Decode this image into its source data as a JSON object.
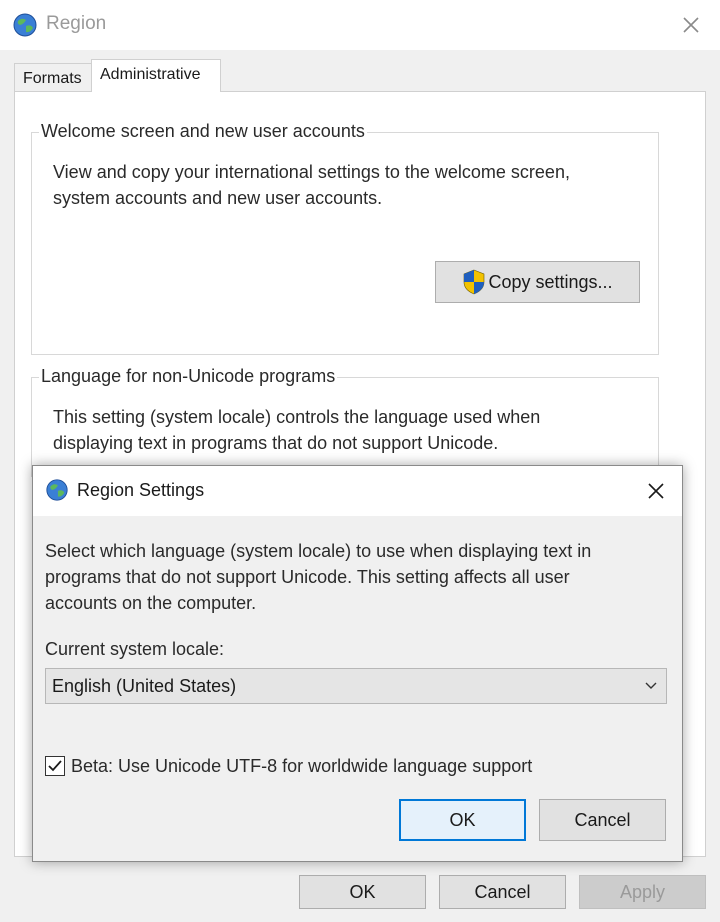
{
  "window": {
    "title": "Region",
    "close_glyph": "✕",
    "tabs": [
      {
        "label": "Formats",
        "active": false
      },
      {
        "label": "Administrative",
        "active": true
      }
    ]
  },
  "welcome_group": {
    "title": "Welcome screen and new user accounts",
    "text_line1": "View and copy your international settings to the welcome screen,",
    "text_line2": "system accounts and new user accounts.",
    "copy_button": "Copy settings...",
    "copy_button_icon": "uac-shield-icon"
  },
  "language_group": {
    "title": "Language for non-Unicode programs",
    "text_line1": "This setting (system locale) controls the language used when",
    "text_line2": "displaying text in programs that do not support Unicode."
  },
  "footer": {
    "ok": "OK",
    "cancel": "Cancel",
    "apply": "Apply",
    "apply_enabled": false
  },
  "dialog": {
    "title": "Region Settings",
    "close_glyph": "✕",
    "description_line1": "Select which language (system locale) to use when displaying text in",
    "description_line2": "programs that do not support Unicode. This setting affects all user",
    "description_line3": "accounts on the computer.",
    "locale_label": "Current system locale:",
    "locale_value": "English (United States)",
    "chevron_glyph": "⌄",
    "beta_checkbox": {
      "label": "Beta: Use Unicode UTF-8 for worldwide language support",
      "checked": true
    },
    "ok": "OK",
    "cancel": "Cancel"
  },
  "colors": {
    "accent": "#0078d7",
    "background": "#f0f0f0",
    "shield_blue": "#1f5fbf",
    "shield_yellow": "#f2c200"
  }
}
